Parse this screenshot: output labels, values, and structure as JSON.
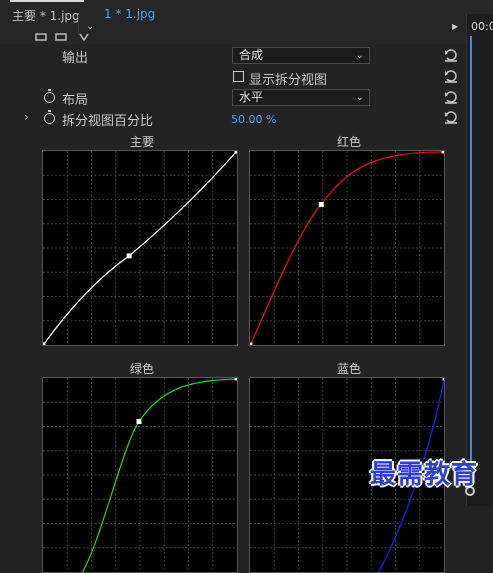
{
  "tabs": {
    "main_label": "主要 * 1.jpg",
    "seq_label": "1 * 1.jpg",
    "dropdown_icon": "chevron-down-icon"
  },
  "timeline": {
    "time_label": "00:0",
    "playhead_color": "#3b8fe0"
  },
  "controls": {
    "output_label": "输出",
    "output_value": "合成",
    "split_view_label": "显示拆分视图",
    "split_view_checked": false,
    "layout_label": "布局",
    "layout_value": "水平",
    "split_percent_label": "拆分视图百分比",
    "split_percent_value": "50.00 %"
  },
  "graphs": {
    "main": {
      "title": "主要",
      "color": "#ffffff"
    },
    "red": {
      "title": "红色",
      "color": "#e01010"
    },
    "green": {
      "title": "绿色",
      "color": "#18d018"
    },
    "blue": {
      "title": "蓝色",
      "color": "#1a1aff"
    }
  },
  "watermark": "最需教育"
}
